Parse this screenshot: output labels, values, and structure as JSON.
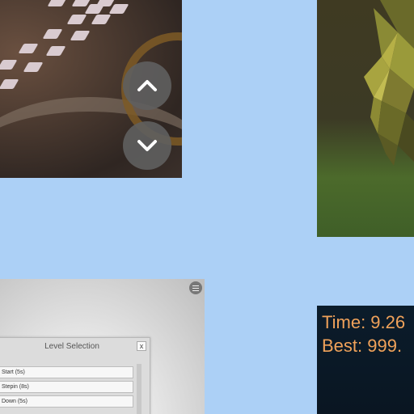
{
  "track_view": {
    "up_icon": "chevron-up-icon",
    "down_icon": "chevron-down-icon"
  },
  "level_selection": {
    "title": "Level Selection",
    "close_label": "x",
    "items": [
      {
        "label": "Start (5s)"
      },
      {
        "label": "Stepin (8s)"
      },
      {
        "label": "Down (5s)"
      }
    ],
    "menu_icon": "hamburger-icon"
  },
  "hud": {
    "time_label": "Time: 9.26",
    "best_label": "Best: 999."
  },
  "colors": {
    "background": "#acd0f6",
    "hud_text": "#f0a25a"
  }
}
